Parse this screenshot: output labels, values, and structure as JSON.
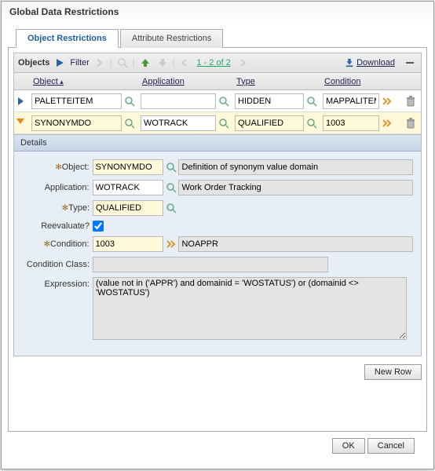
{
  "dialog_title": "Global Data Restrictions",
  "tabs": {
    "object": "Object Restrictions",
    "attribute": "Attribute Restrictions"
  },
  "toolbar": {
    "label": "Objects",
    "filter": "Filter",
    "range": "1 - 2 of 2",
    "download": "Download"
  },
  "columns": {
    "object": "Object",
    "application": "Application",
    "type": "Type",
    "condition": "Condition"
  },
  "rows": [
    {
      "object": "PALETTEITEM",
      "application": "",
      "type": "HIDDEN",
      "condition": "MAPPALITEM",
      "selected": false
    },
    {
      "object": "SYNONYMDO",
      "application": "WOTRACK",
      "type": "QUALIFIED",
      "condition": "1003",
      "selected": true
    }
  ],
  "details": {
    "header": "Details",
    "fields": {
      "object_label": "Object:",
      "object_value": "SYNONYMDO",
      "object_desc": "Definition of synonym value domain",
      "application_label": "Application:",
      "application_value": "WOTRACK",
      "application_desc": "Work Order Tracking",
      "type_label": "Type:",
      "type_value": "QUALIFIED",
      "reeval_label": "Reevaluate?",
      "reeval_checked": true,
      "condition_label": "Condition:",
      "condition_value": "1003",
      "condition_desc": "NOAPPR",
      "condclass_label": "Condition Class:",
      "condclass_value": "",
      "expr_label": "Expression:",
      "expr_value": "(value not in ('APPR') and domainid = 'WOSTATUS') or (domainid <> 'WOSTATUS')"
    }
  },
  "buttons": {
    "new_row": "New Row",
    "ok": "OK",
    "cancel": "Cancel"
  }
}
